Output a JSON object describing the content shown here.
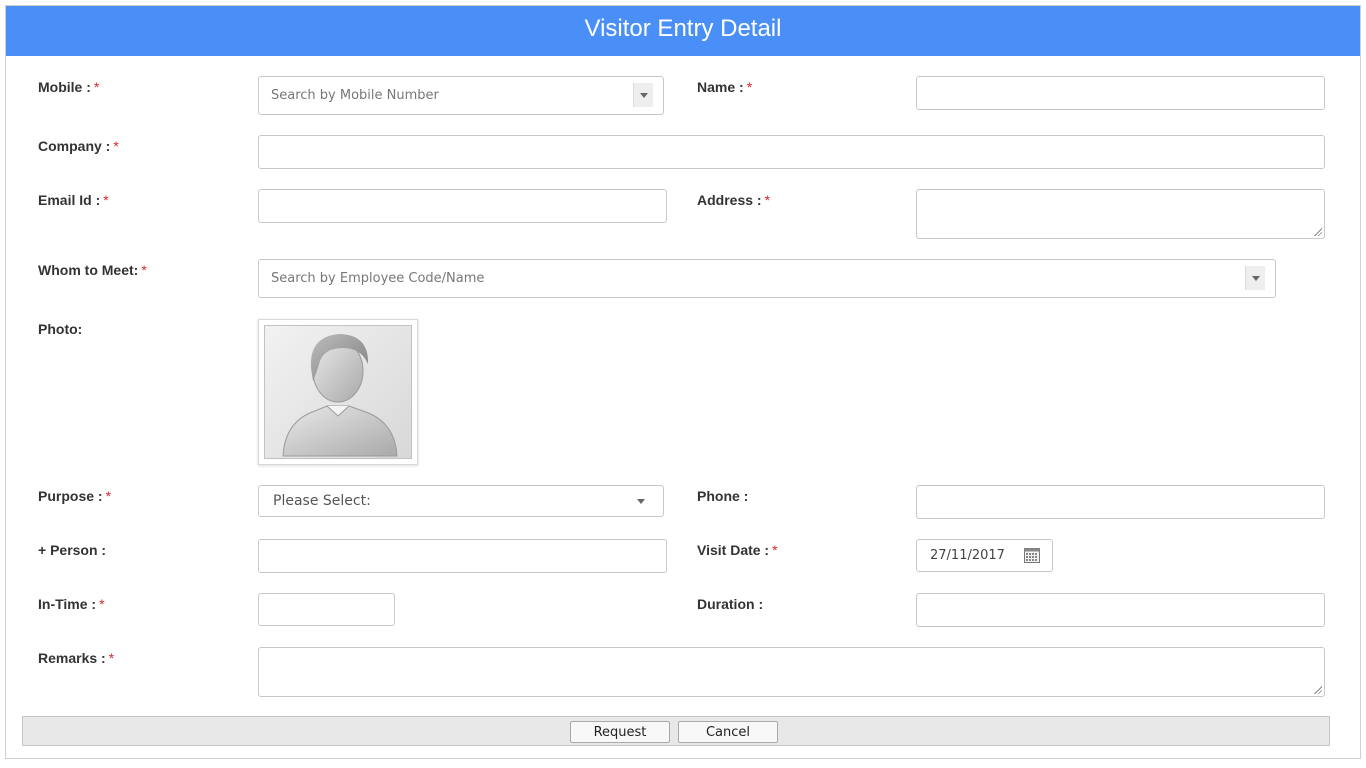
{
  "header": {
    "title": "Visitor Entry Detail"
  },
  "form": {
    "mobile": {
      "label": "Mobile :",
      "req": "*",
      "placeholder": "Search by Mobile Number"
    },
    "name": {
      "label": "Name :",
      "req": "*",
      "value": ""
    },
    "company": {
      "label": "Company :",
      "req": "*",
      "value": ""
    },
    "email": {
      "label": "Email Id :",
      "req": "*",
      "value": ""
    },
    "address": {
      "label": "Address :",
      "req": "*",
      "value": ""
    },
    "whom": {
      "label": "Whom to Meet:",
      "req": "*",
      "placeholder": "Search by Employee Code/Name"
    },
    "photo": {
      "label": "Photo:"
    },
    "purpose": {
      "label": "Purpose :",
      "req": "*",
      "selected": "Please Select:"
    },
    "phone": {
      "label": "Phone :",
      "value": ""
    },
    "person": {
      "label": "+ Person :",
      "value": ""
    },
    "visit_date": {
      "label": "Visit Date :",
      "req": "*",
      "value": "27/11/2017"
    },
    "in_time": {
      "label": "In-Time :",
      "req": "*",
      "value": ""
    },
    "duration": {
      "label": "Duration :",
      "value": ""
    },
    "remarks": {
      "label": "Remarks :",
      "req": "*",
      "value": ""
    }
  },
  "footer": {
    "request_label": "Request",
    "cancel_label": "Cancel"
  },
  "icons": {
    "mobile_dropdown": "chevron-down-icon",
    "whom_dropdown": "chevron-down-icon",
    "purpose_dropdown": "chevron-down-icon",
    "calendar": "calendar-icon",
    "photo": "avatar-placeholder"
  },
  "colors": {
    "header_bg": "#4a8ff7",
    "required": "#e0242b"
  }
}
